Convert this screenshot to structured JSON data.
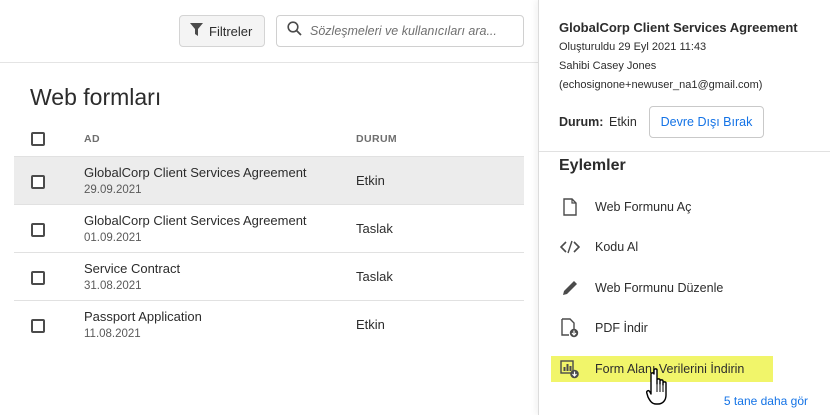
{
  "toolbar": {
    "filter_label": "Filtreler",
    "search_placeholder": "Sözleşmeleri ve kullanıcıları ara..."
  },
  "list": {
    "title": "Web formları",
    "columns": {
      "name": "AD",
      "status": "DURUM"
    },
    "rows": [
      {
        "name": "GlobalCorp Client Services Agreement",
        "date": "29.09.2021",
        "status": "Etkin",
        "selected": true
      },
      {
        "name": "GlobalCorp Client Services Agreement",
        "date": "01.09.2021",
        "status": "Taslak",
        "selected": false
      },
      {
        "name": "Service Contract",
        "date": "31.08.2021",
        "status": "Taslak",
        "selected": false
      },
      {
        "name": "Passport Application",
        "date": "11.08.2021",
        "status": "Etkin",
        "selected": false
      }
    ]
  },
  "panel": {
    "title": "GlobalCorp Client Services Agreement",
    "created": "Oluşturuldu 29 Eyl 2021 11:43",
    "owner": "Sahibi Casey Jones",
    "email": "(echosignone+newuser_na1@gmail.com)",
    "status_label": "Durum:",
    "status_value": "Etkin",
    "deactivate_label": "Devre Dışı Bırak",
    "actions_title": "Eylemler",
    "actions": [
      {
        "label": "Web Formunu Aç",
        "icon": "document-icon"
      },
      {
        "label": "Kodu Al",
        "icon": "code-icon"
      },
      {
        "label": "Web Formunu Düzenle",
        "icon": "pencil-icon"
      },
      {
        "label": "PDF İndir",
        "icon": "pdf-download-icon"
      },
      {
        "label": "Form Alanı Verilerini İndirin",
        "icon": "data-download-icon"
      }
    ],
    "more_link": "5 tane daha gör"
  },
  "colors": {
    "link": "#1473e6",
    "highlight": "#f1f56a",
    "selected_row": "#ececec"
  }
}
